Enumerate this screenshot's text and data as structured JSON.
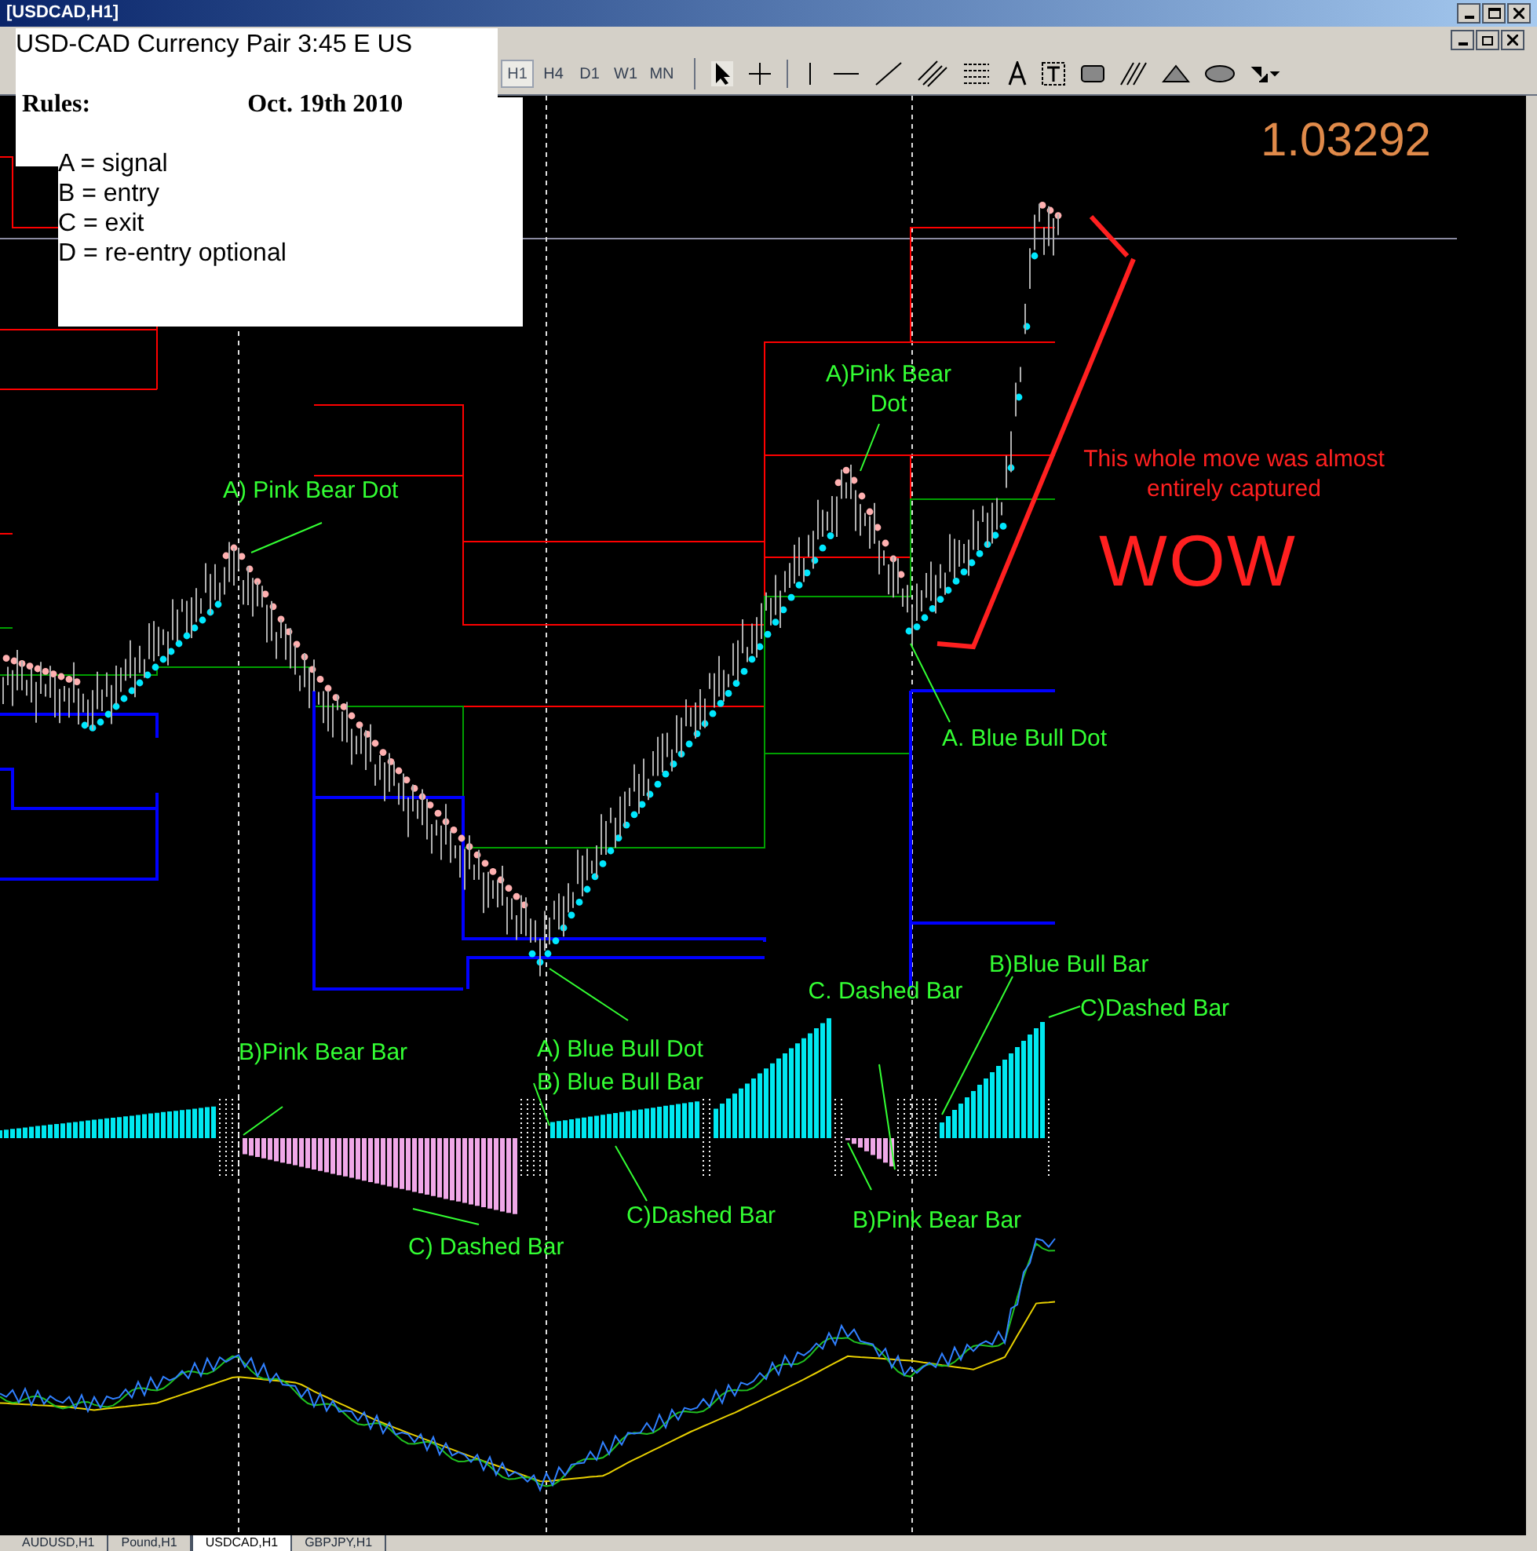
{
  "window": {
    "title": "[USDCAD,H1]"
  },
  "toolbar": {
    "timeframes": [
      {
        "label": "H1",
        "selected": true
      },
      {
        "label": "H4",
        "selected": false
      },
      {
        "label": "D1",
        "selected": false
      },
      {
        "label": "W1",
        "selected": false
      },
      {
        "label": "MN",
        "selected": false
      }
    ]
  },
  "note": {
    "title": "USD-CAD Currency Pair 3:45 E US",
    "heading": "Rules:",
    "date": "Oct. 19th 2010",
    "rules": [
      "A = signal",
      "B = entry",
      "C = exit",
      "D = re-entry optional"
    ]
  },
  "chart": {
    "price": "1.03292",
    "annotations": [
      {
        "text": "A) Pink Bear Dot",
        "color": "#33ff33"
      },
      {
        "text": "A)Pink Bear Dot",
        "color": "#33ff33"
      },
      {
        "text": "This whole move was almost entirely captured",
        "color": "#ff2020"
      },
      {
        "text": "WOW",
        "color": "#ff2020"
      },
      {
        "text": "A. Blue Bull Dot",
        "color": "#33ff33"
      },
      {
        "text": "A) Blue Bull Dot",
        "color": "#33ff33"
      },
      {
        "text": "B) Blue Bull Bar",
        "color": "#33ff33"
      },
      {
        "text": "B)Pink Bear Bar",
        "color": "#33ff33"
      },
      {
        "text": "C) Dashed Bar",
        "color": "#33ff33"
      },
      {
        "text": "C)Dashed Bar",
        "color": "#33ff33"
      },
      {
        "text": "C. Dashed Bar",
        "color": "#33ff33"
      },
      {
        "text": "B)Pink Bear Bar",
        "color": "#33ff33"
      },
      {
        "text": "B)Blue Bull Bar",
        "color": "#33ff33"
      },
      {
        "text": "C)Dashed Bar",
        "color": "#33ff33"
      }
    ]
  },
  "tabs": [
    {
      "label": "AUDUSD,H1",
      "selected": false
    },
    {
      "label": "Pound,H1",
      "selected": false
    },
    {
      "label": "USDCAD,H1",
      "selected": true
    },
    {
      "label": "GBPJPY,H1",
      "selected": false
    }
  ]
}
